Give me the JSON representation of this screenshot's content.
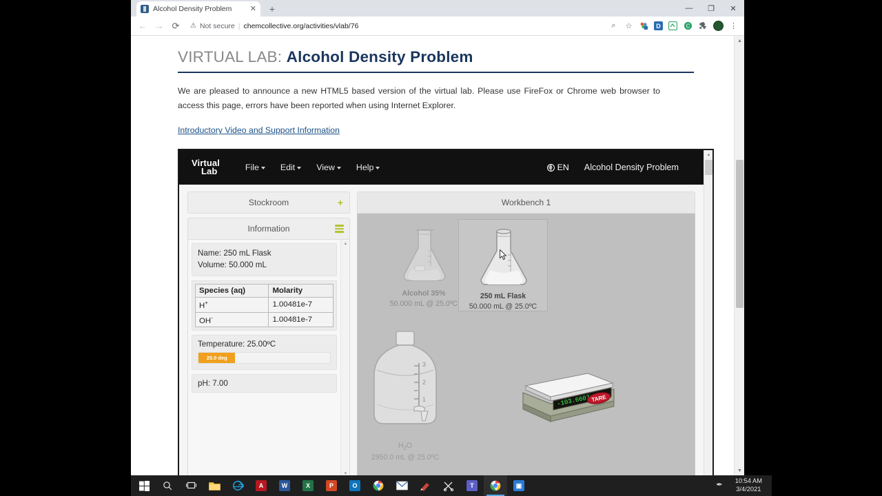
{
  "browser": {
    "tab_title": "Alcohol Density Problem",
    "tab_close": "✕",
    "new_tab": "+",
    "win_min": "—",
    "win_max": "❐",
    "win_close": "✕",
    "back": "←",
    "forward": "→",
    "reload": "⟳",
    "security_label": "Not secure",
    "separator": "|",
    "url": "chemcollective.org/activities/vlab/76",
    "zoom_icon": "⌕",
    "bookmark_icon": "☆",
    "ext_d": "D",
    "menu_icon": "⋮"
  },
  "page": {
    "title_prefix": "VIRTUAL LAB: ",
    "title_main": "Alcohol Density Problem",
    "announcement": "We are pleased to announce a new HTML5 based version of the virtual lab. Please use FireFox or Chrome web browser to access this page, errors have been reported when using Internet Explorer.",
    "support_link": "Introductory Video and Support Information"
  },
  "vlab": {
    "brand_line1": "Virtual",
    "brand_line2": "Lab",
    "menus": [
      {
        "label": "File"
      },
      {
        "label": "Edit"
      },
      {
        "label": "View"
      },
      {
        "label": "Help"
      }
    ],
    "language": "EN",
    "problem_title": "Alcohol Density Problem",
    "stockroom": {
      "label": "Stockroom",
      "add_icon": "+"
    },
    "information": {
      "label": "Information",
      "name_line": "Name: 250 mL Flask",
      "volume_line": "Volume: 50.000 mL",
      "table": {
        "headers": [
          "Species (aq)",
          "Molarity"
        ],
        "rows": [
          {
            "species": "H",
            "charge": "+",
            "molarity": "1.00481e-7"
          },
          {
            "species": "OH",
            "charge": "-",
            "molarity": "1.00481e-7"
          }
        ]
      },
      "temperature_line": "Temperature: 25.00ºC",
      "temperature_badge": "25.0 deg",
      "ph_line": "pH: 7.00"
    },
    "workbench": {
      "label": "Workbench 1",
      "items": [
        {
          "name": "Alcohol 35%",
          "detail": "50.000 mL @ 25.0ºC",
          "selected": false
        },
        {
          "name": "250 mL Flask",
          "detail": "50.000 mL @ 25.0ºC",
          "selected": true
        }
      ],
      "water_bottle": {
        "name": "H2O",
        "name_sub": "2",
        "detail": "2950.0 mL @ 25.0ºC"
      },
      "balance": {
        "reading": "-103.6607 g",
        "tare_label": "TARE"
      }
    }
  },
  "taskbar": {
    "start_icon": "⊞",
    "search_icon": "⌕",
    "taskview_icon": "❑",
    "apps": [
      {
        "name": "file-explorer",
        "glyph": "📁",
        "color": "#f2c14e"
      },
      {
        "name": "internet-explorer",
        "glyph": "e",
        "color": "#1e9ad6"
      },
      {
        "name": "adobe-acrobat",
        "glyph": "A",
        "color": "#b5181f"
      },
      {
        "name": "microsoft-word",
        "glyph": "W",
        "color": "#2b579a"
      },
      {
        "name": "microsoft-excel",
        "glyph": "X",
        "color": "#217346"
      },
      {
        "name": "microsoft-powerpoint",
        "glyph": "P",
        "color": "#d24726"
      },
      {
        "name": "microsoft-outlook",
        "glyph": "O",
        "color": "#0072c6"
      },
      {
        "name": "google-chrome",
        "glyph": "◉",
        "color": "#e8e8e8"
      },
      {
        "name": "mail",
        "glyph": "✉",
        "color": "#ffffff"
      },
      {
        "name": "paint",
        "glyph": "✎",
        "color": "#c9443a"
      },
      {
        "name": "vs-code",
        "glyph": "✂",
        "color": "#e8e8e8"
      },
      {
        "name": "microsoft-teams",
        "glyph": "T",
        "color": "#5b5fc7"
      },
      {
        "name": "chrome-active",
        "glyph": "◉",
        "color": "#e8e8e8"
      },
      {
        "name": "video-app",
        "glyph": "▣",
        "color": "#2b7cd3"
      }
    ],
    "pen_icon": "✒",
    "time": "10:54 AM",
    "date": "3/4/2021"
  }
}
